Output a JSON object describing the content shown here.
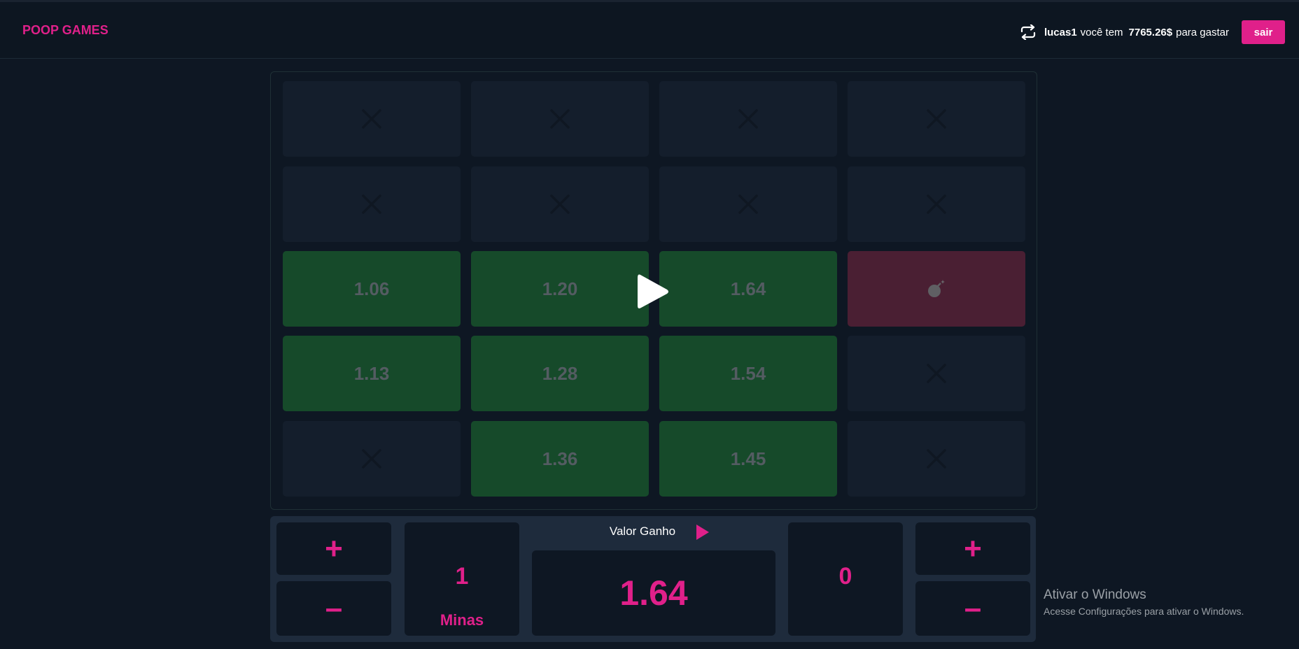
{
  "header": {
    "logo": "POOP GAMES",
    "username": "lucas1",
    "text_before_balance": "você tem",
    "balance": "7765.26$",
    "text_after_balance": "para gastar",
    "logout_label": "sair"
  },
  "board": {
    "rows": [
      [
        {
          "state": "closed"
        },
        {
          "state": "closed"
        },
        {
          "state": "closed"
        },
        {
          "state": "closed"
        }
      ],
      [
        {
          "state": "closed"
        },
        {
          "state": "closed"
        },
        {
          "state": "closed"
        },
        {
          "state": "closed"
        }
      ],
      [
        {
          "state": "gem",
          "value": "1.06"
        },
        {
          "state": "gem",
          "value": "1.20"
        },
        {
          "state": "gem",
          "value": "1.64"
        },
        {
          "state": "bomb",
          "icon": "bomb-icon"
        }
      ],
      [
        {
          "state": "gem",
          "value": "1.13"
        },
        {
          "state": "gem",
          "value": "1.28"
        },
        {
          "state": "gem",
          "value": "1.54"
        },
        {
          "state": "closed"
        }
      ],
      [
        {
          "state": "closed"
        },
        {
          "state": "gem",
          "value": "1.36"
        },
        {
          "state": "gem",
          "value": "1.45"
        },
        {
          "state": "closed"
        }
      ]
    ]
  },
  "controls": {
    "mines_plus": "+",
    "mines_minus": "–",
    "mines_count": "1",
    "mines_label": "Minas",
    "valor_label": "Valor Ganho",
    "valor_value": "1.64",
    "bet_value": "0",
    "bet_plus": "+",
    "bet_minus": "–"
  },
  "watermark": {
    "title": "Ativar o Windows",
    "subtitle": "Acesse Configurações para ativar o Windows."
  },
  "colors": {
    "accent": "#e0208a",
    "background": "#0e1723",
    "tile_closed": "#141e2c",
    "tile_gem": "#164a2a",
    "tile_bomb": "#4a1f33",
    "control_panel": "#1e2b3c"
  }
}
